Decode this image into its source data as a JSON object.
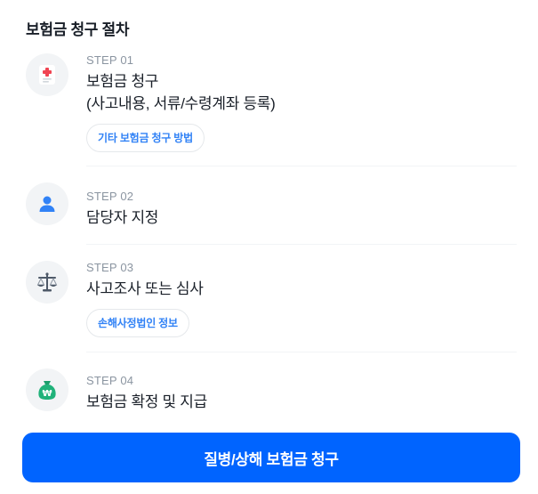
{
  "section_title": "보험금 청구 절차",
  "steps": [
    {
      "step_label": "STEP 01",
      "title": "보험금 청구\n(사고내용, 서류/수령계좌 등록)",
      "link_label": "기타 보험금 청구 방법",
      "icon": "medical-document-icon"
    },
    {
      "step_label": "STEP 02",
      "title": "담당자 지정",
      "icon": "person-icon"
    },
    {
      "step_label": "STEP 03",
      "title": "사고조사 또는 심사",
      "link_label": "손해사정법인 정보",
      "icon": "scale-icon"
    },
    {
      "step_label": "STEP 04",
      "title": "보험금 확정 및 지급",
      "icon": "money-bag-icon"
    }
  ],
  "cta_label": "질병/상해 보험금 청구",
  "colors": {
    "accent": "#0064ff",
    "link": "#3182f6",
    "icon_bg": "#f2f4f6",
    "step_label": "#8b95a1",
    "red": "#f04452",
    "green": "#20b27a"
  }
}
